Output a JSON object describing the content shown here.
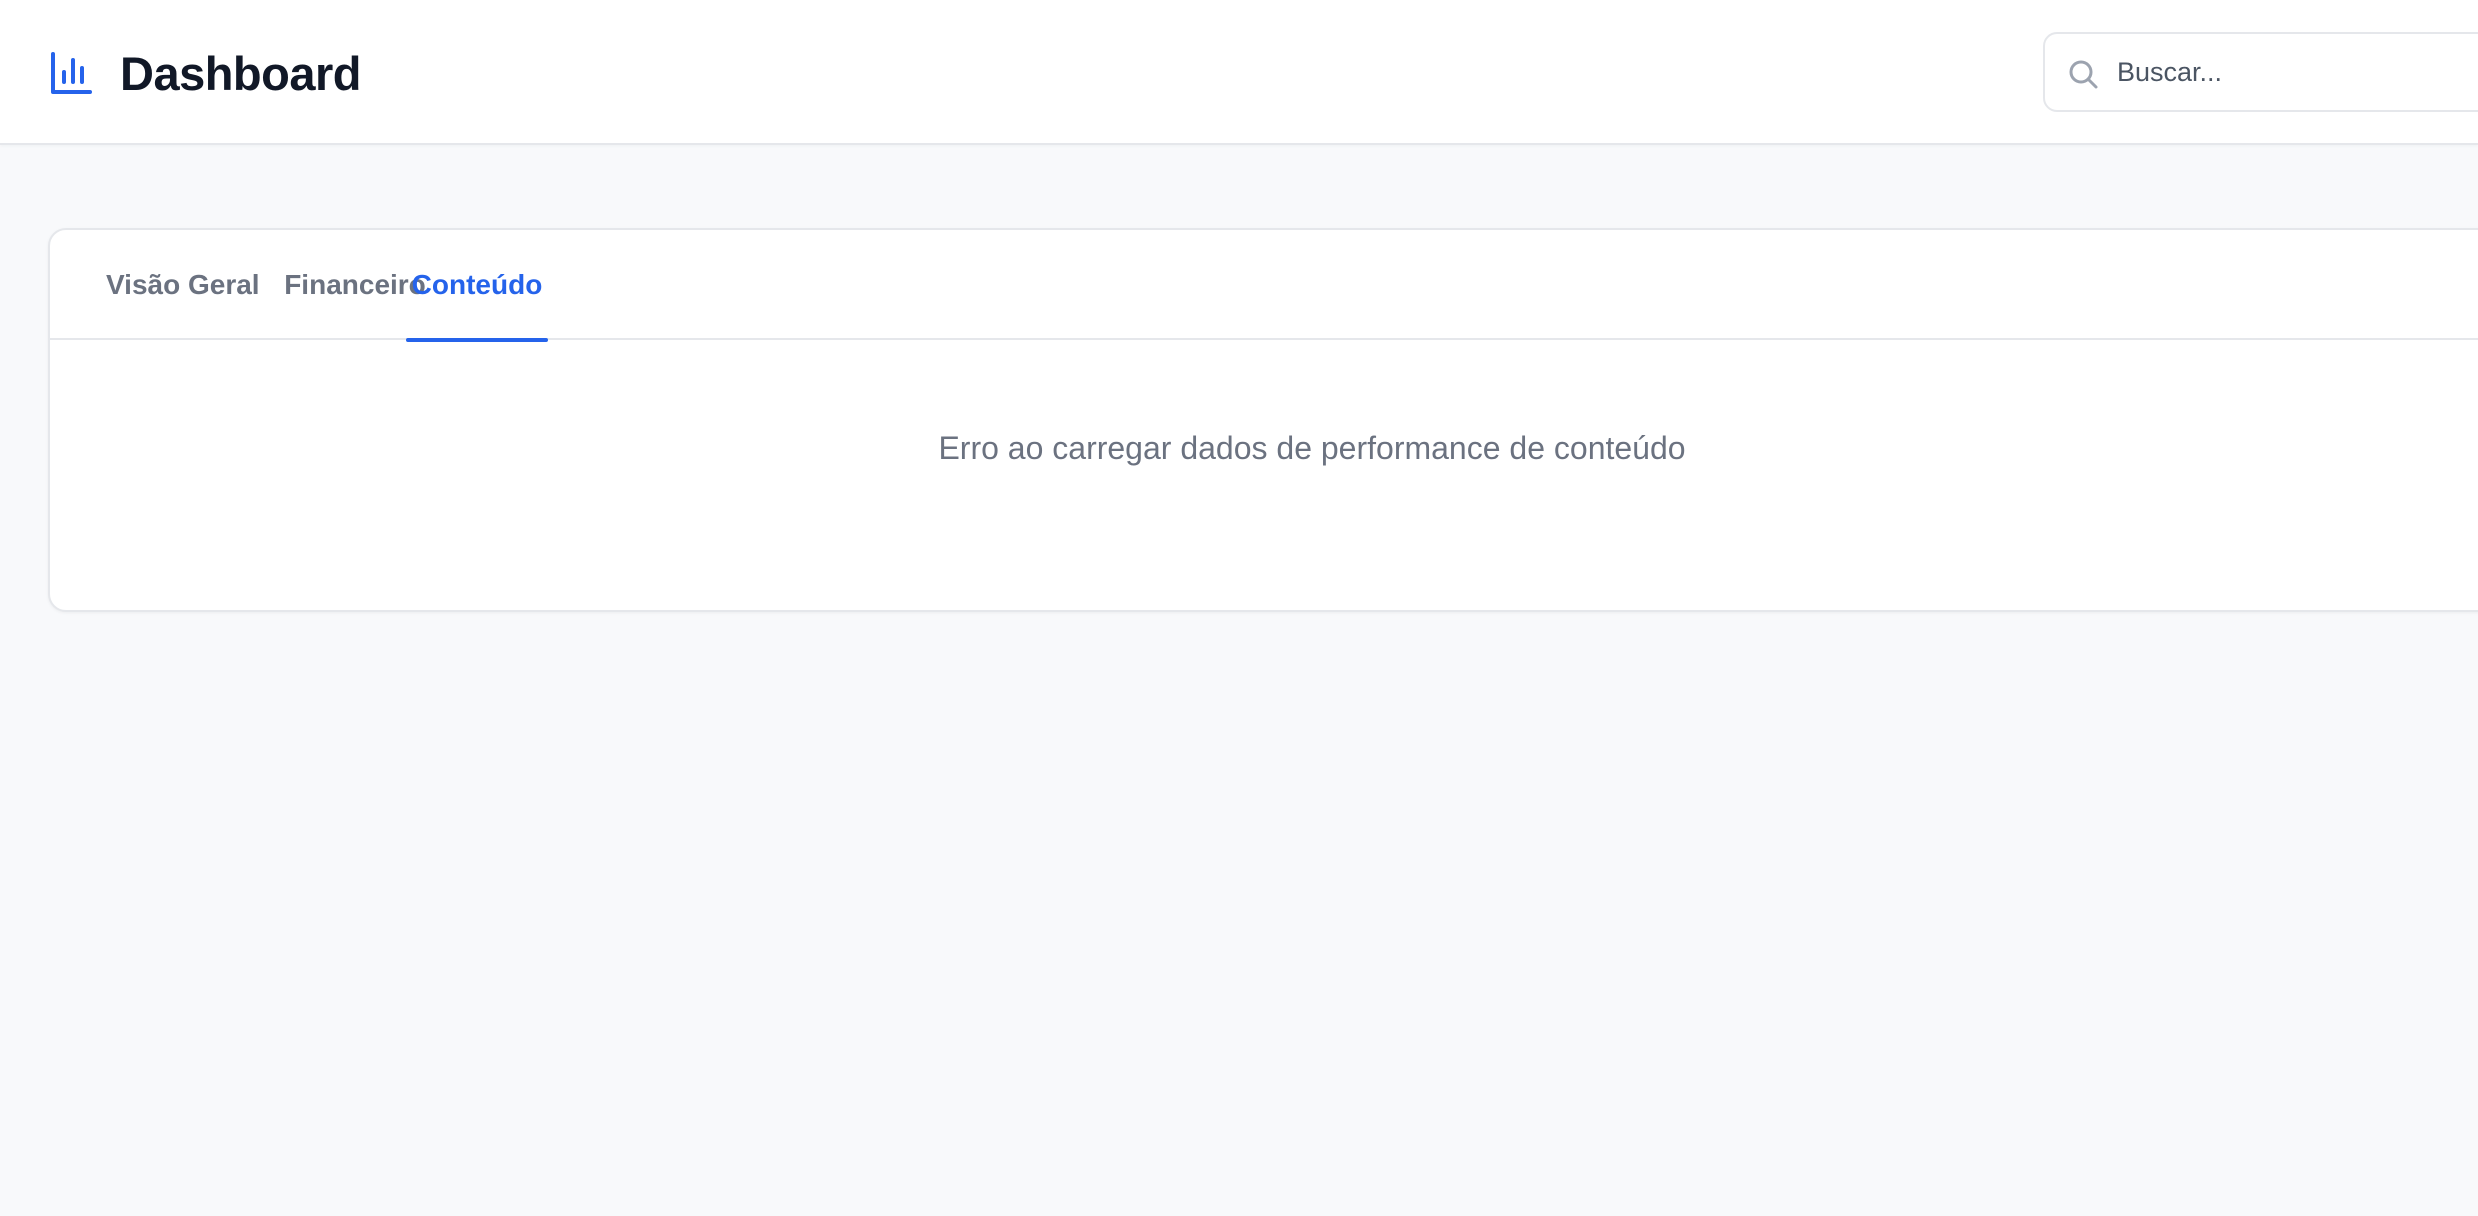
{
  "header": {
    "title": "Dashboard",
    "logo_icon": "bar-chart-icon",
    "accent_color": "#2563eb"
  },
  "search": {
    "placeholder": "Buscar...",
    "value": "",
    "icon": "search-icon"
  },
  "tabs": [
    {
      "label": "Visão Geral",
      "active": false
    },
    {
      "label": "Financeiro",
      "active": false
    },
    {
      "label": "Conteúdo",
      "active": true
    }
  ],
  "content": {
    "message": "Erro ao carregar dados de performance de conteúdo"
  }
}
